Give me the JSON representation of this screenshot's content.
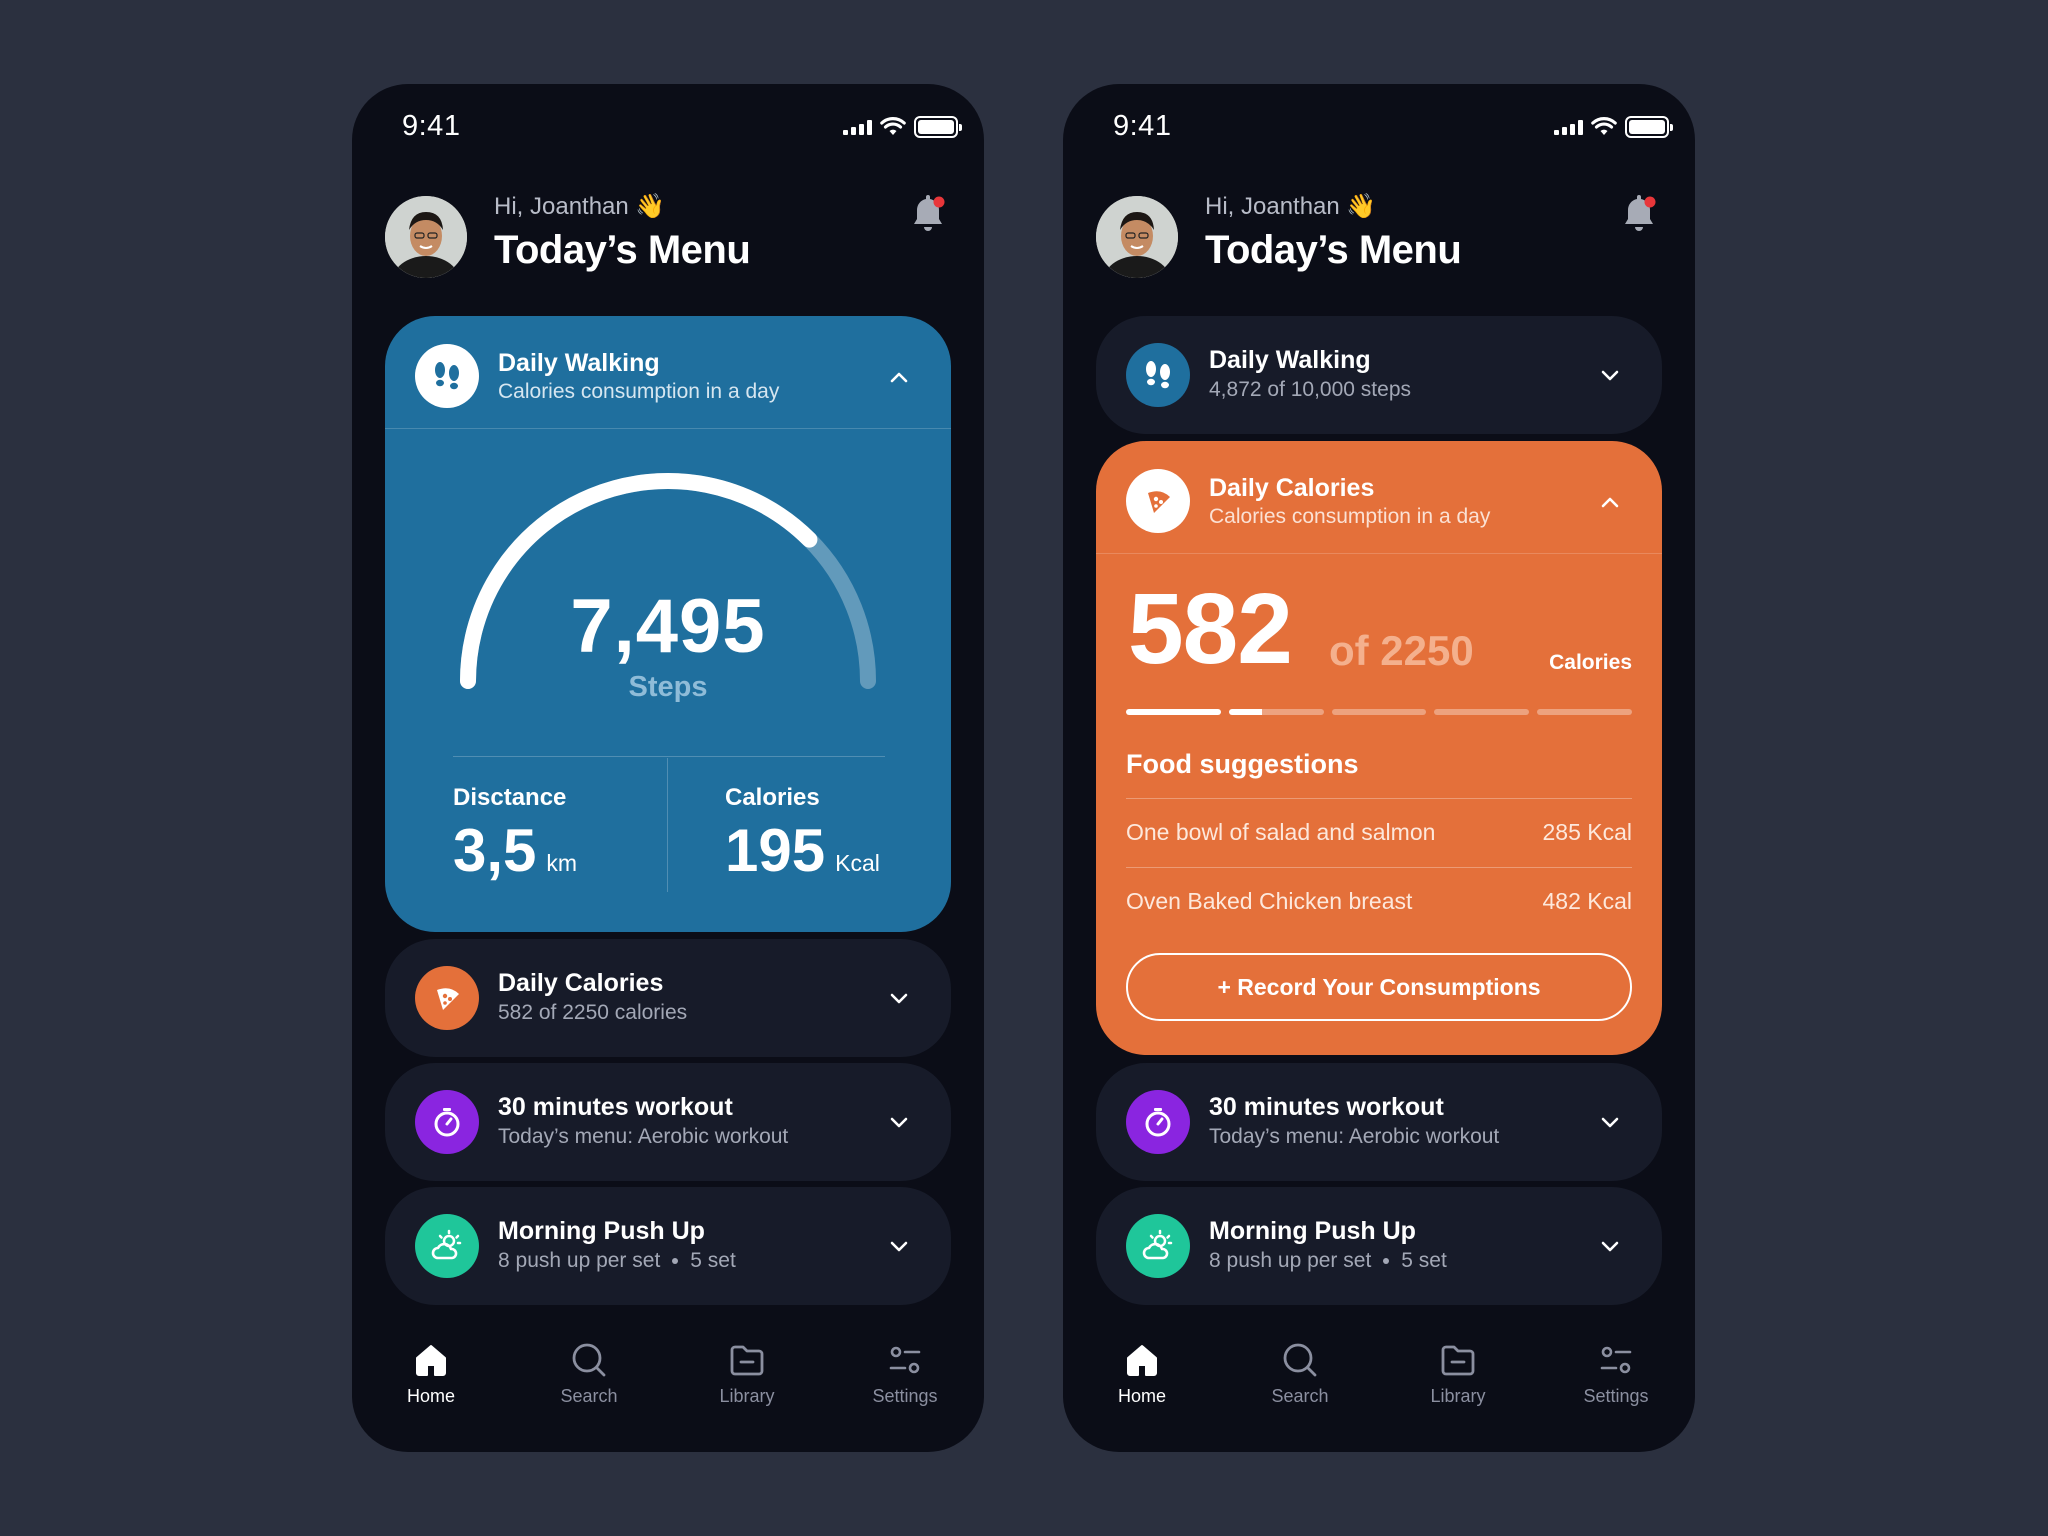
{
  "colors": {
    "background": "#2b303f",
    "phone": "#0b0d17",
    "card": "#171b29",
    "blue": "#1f6f9e",
    "orange": "#e4703a",
    "purple": "#8a25e0",
    "teal": "#1fc69a",
    "notification_dot": "#e8363a"
  },
  "left": {
    "status": {
      "time": "9:41"
    },
    "header": {
      "greeting": "Hi, Joanthan 👋",
      "title": "Today’s Menu"
    },
    "walking": {
      "title": "Daily Walking",
      "subtitle": "Calories consumption in a day",
      "steps_value": "7,495",
      "steps_label": "Steps",
      "steps_progress": 0.75,
      "distance_label": "Disctance",
      "distance_value": "3,5",
      "distance_unit": "km",
      "calories_label": "Calories",
      "calories_value": "195",
      "calories_unit": "Kcal"
    },
    "calories_card": {
      "title": "Daily Calories",
      "subtitle": "582 of 2250 calories"
    },
    "workout_card": {
      "title": "30 minutes workout",
      "subtitle": "Today’s menu: Aerobic workout"
    },
    "pushup_card": {
      "title": "Morning Push Up",
      "subtitle_reps": "8 push up per set",
      "subtitle_sets": "5 set"
    }
  },
  "right": {
    "status": {
      "time": "9:41"
    },
    "header": {
      "greeting": "Hi, Joanthan 👋",
      "title": "Today’s Menu"
    },
    "walking_card": {
      "title": "Daily Walking",
      "subtitle": "4,872 of 10,000 steps"
    },
    "calories": {
      "title": "Daily Calories",
      "subtitle": "Calories consumption in a day",
      "value": "582",
      "of_total": "of 2250",
      "unit": "Calories",
      "progress_segments_full": 1,
      "progress_segments_partial": 0.35,
      "progress_segments_total": 5,
      "suggestions_heading": "Food suggestions",
      "suggestions": [
        {
          "name": "One bowl of salad and salmon",
          "kcal": "285 Kcal"
        },
        {
          "name": "Oven Baked Chicken breast",
          "kcal": "482 Kcal"
        }
      ],
      "record_button": "+ Record Your Consumptions"
    },
    "workout_card": {
      "title": "30 minutes workout",
      "subtitle": "Today’s menu: Aerobic workout"
    },
    "pushup_card": {
      "title": "Morning Push Up",
      "subtitle_reps": "8 push up per set",
      "subtitle_sets": "5 set"
    }
  },
  "nav": {
    "items": [
      {
        "label": "Home",
        "icon": "home-icon",
        "active": true
      },
      {
        "label": "Search",
        "icon": "search-icon",
        "active": false
      },
      {
        "label": "Library",
        "icon": "folder-icon",
        "active": false
      },
      {
        "label": "Settings",
        "icon": "settings-icon",
        "active": false
      }
    ]
  }
}
